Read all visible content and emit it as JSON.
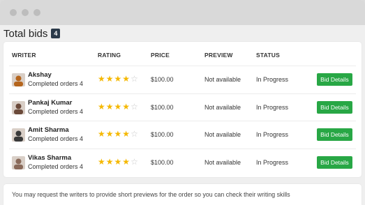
{
  "page": {
    "title": "Total bids",
    "count": "4"
  },
  "table": {
    "headers": {
      "writer": "WRITER",
      "rating": "RATING",
      "price": "PRICE",
      "preview": "PREVIEW",
      "status": "STATUS"
    },
    "rows": [
      {
        "name": "Akshay",
        "orders": "Completed orders 4",
        "rating": 4,
        "price": "$100.00",
        "preview": "Not available",
        "status": "In Progress",
        "action": "Bid Details",
        "avatar_color": "#b5651d"
      },
      {
        "name": "Pankaj Kumar",
        "orders": "Completed orders 4",
        "rating": 4,
        "price": "$100.00",
        "preview": "Not available",
        "status": "In Progress",
        "action": "Bid Details",
        "avatar_color": "#6b4a3a"
      },
      {
        "name": "Amit Sharma",
        "orders": "Completed orders 4",
        "rating": 4,
        "price": "$100.00",
        "preview": "Not available",
        "status": "In Progress",
        "action": "Bid Details",
        "avatar_color": "#3a3a3a"
      },
      {
        "name": "Vikas Sharma",
        "orders": "Completed orders 4",
        "rating": 4,
        "price": "$100.00",
        "preview": "Not available",
        "status": "In Progress",
        "action": "Bid Details",
        "avatar_color": "#8a6a5a"
      }
    ],
    "max_rating": 5
  },
  "footer_note": "You may request the writers to provide short previews for the order so you can check their writing skills",
  "colors": {
    "accent_green": "#28a745",
    "star_on": "#f5b800",
    "star_off": "#c8c8c8",
    "badge_bg": "#2b3a4a"
  }
}
